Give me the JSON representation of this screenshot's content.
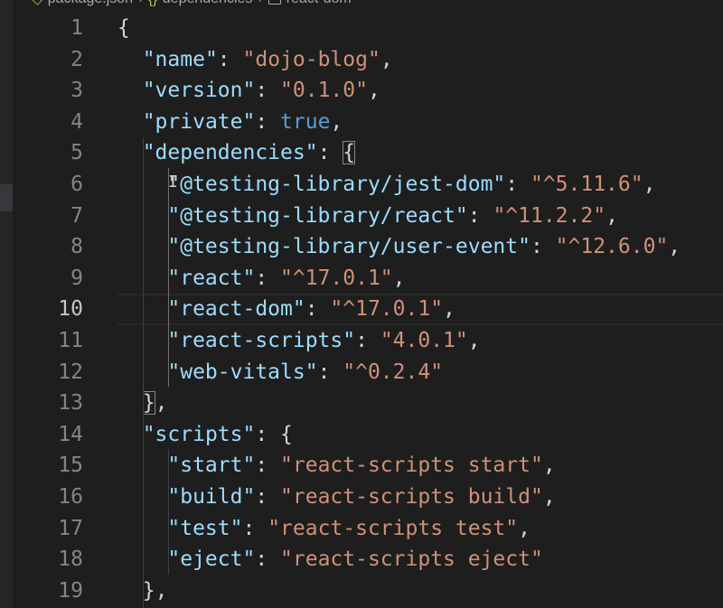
{
  "breadcrumb": {
    "file": "package.json",
    "object_icon": "{}",
    "object": "dependencies",
    "leaf": "react-dom"
  },
  "editor": {
    "current_line": 10,
    "lines": [
      {
        "num": "1",
        "indent": "",
        "tokens": [
          {
            "t": "p",
            "v": "{"
          }
        ]
      },
      {
        "num": "2",
        "indent": "  ",
        "tokens": [
          {
            "t": "k",
            "v": "\"name\""
          },
          {
            "t": "p",
            "v": ": "
          },
          {
            "t": "s",
            "v": "\"dojo-blog\""
          },
          {
            "t": "p",
            "v": ","
          }
        ]
      },
      {
        "num": "3",
        "indent": "  ",
        "tokens": [
          {
            "t": "k",
            "v": "\"version\""
          },
          {
            "t": "p",
            "v": ": "
          },
          {
            "t": "s",
            "v": "\"0.1.0\""
          },
          {
            "t": "p",
            "v": ","
          }
        ]
      },
      {
        "num": "4",
        "indent": "  ",
        "tokens": [
          {
            "t": "k",
            "v": "\"private\""
          },
          {
            "t": "p",
            "v": ": "
          },
          {
            "t": "b",
            "v": "true"
          },
          {
            "t": "p",
            "v": ","
          }
        ]
      },
      {
        "num": "5",
        "indent": "  ",
        "tokens": [
          {
            "t": "k",
            "v": "\"dependencies\""
          },
          {
            "t": "p",
            "v": ": "
          },
          {
            "t": "p",
            "v": "{",
            "hl": true
          }
        ]
      },
      {
        "num": "6",
        "indent": "    ",
        "tokens": [
          {
            "t": "k",
            "v": "\"@testing-library/jest-dom\""
          },
          {
            "t": "p",
            "v": ": "
          },
          {
            "t": "s",
            "v": "\"^5.11.6\""
          },
          {
            "t": "p",
            "v": ","
          }
        ]
      },
      {
        "num": "7",
        "indent": "    ",
        "tokens": [
          {
            "t": "k",
            "v": "\"@testing-library/react\""
          },
          {
            "t": "p",
            "v": ": "
          },
          {
            "t": "s",
            "v": "\"^11.2.2\""
          },
          {
            "t": "p",
            "v": ","
          }
        ]
      },
      {
        "num": "8",
        "indent": "    ",
        "tokens": [
          {
            "t": "k",
            "v": "\"@testing-library/user-event\""
          },
          {
            "t": "p",
            "v": ": "
          },
          {
            "t": "s",
            "v": "\"^12.6.0\""
          },
          {
            "t": "p",
            "v": ","
          }
        ]
      },
      {
        "num": "9",
        "indent": "    ",
        "tokens": [
          {
            "t": "k",
            "v": "\"react\""
          },
          {
            "t": "p",
            "v": ": "
          },
          {
            "t": "s",
            "v": "\"^17.0.1\""
          },
          {
            "t": "p",
            "v": ","
          }
        ]
      },
      {
        "num": "10",
        "indent": "    ",
        "tokens": [
          {
            "t": "k",
            "v": "\"react-dom\""
          },
          {
            "t": "p",
            "v": ": "
          },
          {
            "t": "s",
            "v": "\"^17.0.1\""
          },
          {
            "t": "p",
            "v": ","
          }
        ]
      },
      {
        "num": "11",
        "indent": "    ",
        "tokens": [
          {
            "t": "k",
            "v": "\"react-scripts\""
          },
          {
            "t": "p",
            "v": ": "
          },
          {
            "t": "s",
            "v": "\"4.0.1\""
          },
          {
            "t": "p",
            "v": ","
          }
        ]
      },
      {
        "num": "12",
        "indent": "    ",
        "tokens": [
          {
            "t": "k",
            "v": "\"web-vitals\""
          },
          {
            "t": "p",
            "v": ": "
          },
          {
            "t": "s",
            "v": "\"^0.2.4\""
          }
        ]
      },
      {
        "num": "13",
        "indent": "  ",
        "tokens": [
          {
            "t": "p",
            "v": "}",
            "hl": true
          },
          {
            "t": "p",
            "v": ","
          }
        ]
      },
      {
        "num": "14",
        "indent": "  ",
        "tokens": [
          {
            "t": "k",
            "v": "\"scripts\""
          },
          {
            "t": "p",
            "v": ": "
          },
          {
            "t": "p",
            "v": "{"
          }
        ]
      },
      {
        "num": "15",
        "indent": "    ",
        "tokens": [
          {
            "t": "k",
            "v": "\"start\""
          },
          {
            "t": "p",
            "v": ": "
          },
          {
            "t": "s",
            "v": "\"react-scripts start\""
          },
          {
            "t": "p",
            "v": ","
          }
        ]
      },
      {
        "num": "16",
        "indent": "    ",
        "tokens": [
          {
            "t": "k",
            "v": "\"build\""
          },
          {
            "t": "p",
            "v": ": "
          },
          {
            "t": "s",
            "v": "\"react-scripts build\""
          },
          {
            "t": "p",
            "v": ","
          }
        ]
      },
      {
        "num": "17",
        "indent": "    ",
        "tokens": [
          {
            "t": "k",
            "v": "\"test\""
          },
          {
            "t": "p",
            "v": ": "
          },
          {
            "t": "s",
            "v": "\"react-scripts test\""
          },
          {
            "t": "p",
            "v": ","
          }
        ]
      },
      {
        "num": "18",
        "indent": "    ",
        "tokens": [
          {
            "t": "k",
            "v": "\"eject\""
          },
          {
            "t": "p",
            "v": ": "
          },
          {
            "t": "s",
            "v": "\"react-scripts eject\""
          }
        ]
      },
      {
        "num": "19",
        "indent": "  ",
        "tokens": [
          {
            "t": "p",
            "v": "}"
          },
          {
            "t": "p",
            "v": ","
          }
        ]
      }
    ]
  },
  "colors": {
    "background": "#1e1e1e",
    "json_key": "#9cdcfe",
    "json_string": "#ce9178",
    "json_boolean": "#569cd6",
    "punctuation": "#d4d4d4",
    "line_number": "#858585",
    "line_number_active": "#c6c6c6"
  },
  "icons": {
    "file_icon": "json-file-icon",
    "object_icon": "braces-icon",
    "leaf_icon": "property-box-icon",
    "cursor": "text-ibeam-cursor"
  }
}
